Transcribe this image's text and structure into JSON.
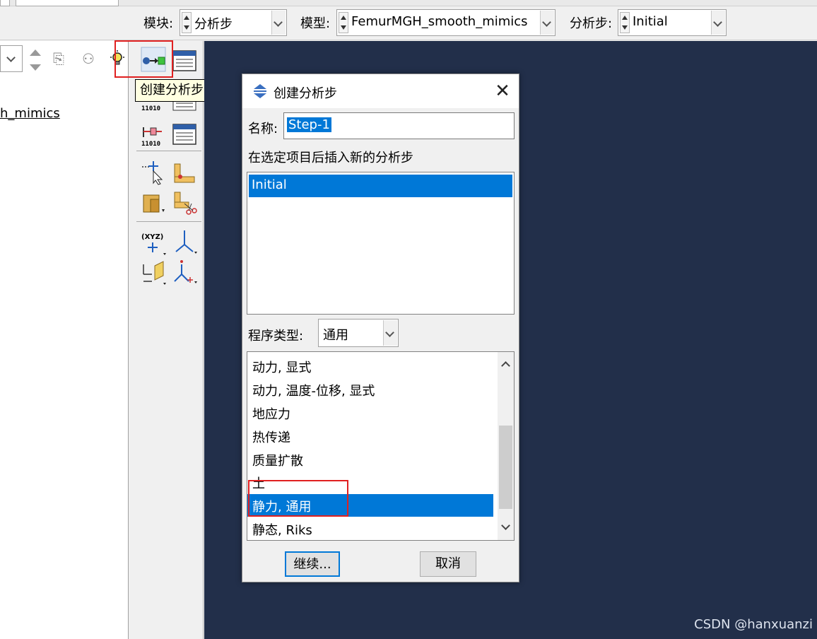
{
  "context_bar": {
    "module_label": "模块:",
    "module_value": "分析步",
    "model_label": "模型:",
    "model_value": "FemurMGH_smooth_mimics",
    "step_label": "分析步:",
    "step_value": "Initial"
  },
  "tree": {
    "model_item": "h_mimics"
  },
  "toolbox": {
    "tooltip": "创建分析步",
    "icons": [
      "create-step-icon",
      "step-manager-icon",
      "field-output-icon",
      "history-output-icon",
      "datum-point-icon",
      "datum-axis-icon",
      "partition-icon",
      "cut-icon",
      "csys-icon",
      "axis-triad-icon",
      "plane-icon",
      "triad-icon"
    ]
  },
  "dialog": {
    "title": "创建分析步",
    "close": "✕",
    "name_label": "名称:",
    "name_value": "Step-1",
    "insert_label": "在选定项目后插入新的分析步",
    "steps": [
      "Initial"
    ],
    "procedure_type_label": "程序类型:",
    "procedure_type_value": "通用",
    "procedures": [
      "动力, 显式",
      "动力, 温度-位移, 显式",
      "地应力",
      "热传递",
      "质量扩散",
      "土",
      "静力, 通用",
      "静态, Riks"
    ],
    "selected_procedure": "静力, 通用",
    "continue_button": "继续...",
    "cancel_button": "取消"
  },
  "watermark": "CSDN @hanxuanzi",
  "colors": {
    "viewport_bg": "#222f4a",
    "selection": "#0078d7",
    "annotation_red": "#e02020"
  }
}
